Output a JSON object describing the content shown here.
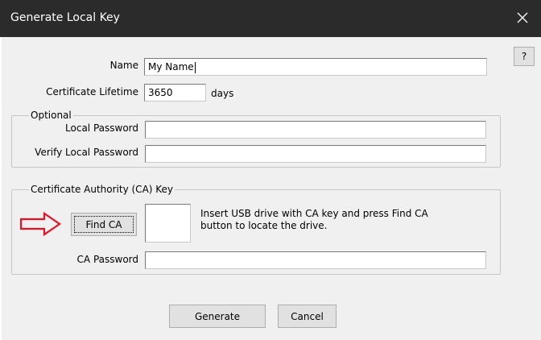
{
  "window": {
    "title": "Generate Local Key",
    "close_glyph": "✕"
  },
  "form": {
    "name_label": "Name",
    "name_value": "My Name",
    "lifetime_label": "Certificate Lifetime",
    "lifetime_value": "3650",
    "lifetime_unit": "days",
    "help_label": "?"
  },
  "optional_group": {
    "title": "Optional",
    "local_password_label": "Local Password",
    "local_password_value": "",
    "verify_password_label": "Verify Local Password",
    "verify_password_value": ""
  },
  "ca_group": {
    "title": "Certificate Authority (CA) Key",
    "find_ca_label": "Find CA",
    "instruction_line1": "Insert USB drive with CA key and press Find CA",
    "instruction_line2": "button to locate the drive.",
    "ca_password_label": "CA Password",
    "ca_password_value": "",
    "arrow_icon": "red-outline-arrow-right",
    "arrow_color": "#e81123"
  },
  "buttons": {
    "generate_label": "Generate",
    "cancel_label": "Cancel"
  },
  "colors": {
    "titlebar_bg": "#2b2b2b",
    "dialog_bg": "#f0f0f0",
    "focus_accent": "#0078d7"
  }
}
